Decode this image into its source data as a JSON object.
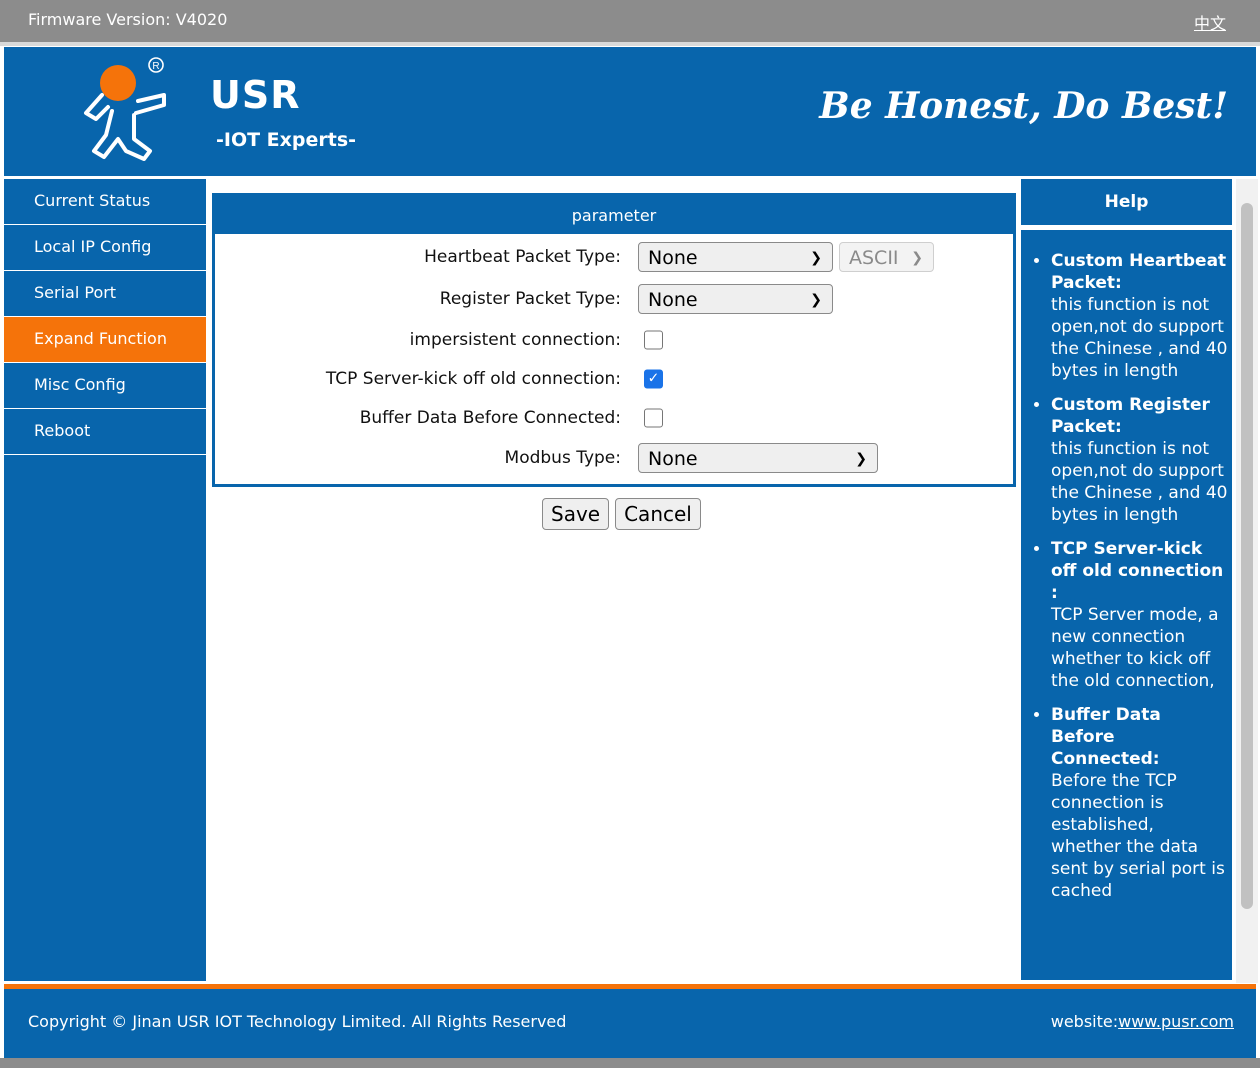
{
  "topbar": {
    "firmware_label": "Firmware Version:",
    "firmware_value": "V4020",
    "language_link": "中文"
  },
  "header": {
    "brand": "USR",
    "tagline": "-IOT Experts-",
    "slogan": "Be Honest, Do Best!"
  },
  "sidebar": {
    "items": [
      {
        "label": "Current Status",
        "active": false
      },
      {
        "label": "Local IP Config",
        "active": false
      },
      {
        "label": "Serial Port",
        "active": false
      },
      {
        "label": "Expand Function",
        "active": true
      },
      {
        "label": "Misc Config",
        "active": false
      },
      {
        "label": "Reboot",
        "active": false
      }
    ]
  },
  "panel": {
    "title": "parameter",
    "heartbeat_label": "Heartbeat Packet Type:",
    "heartbeat_value": "None",
    "heartbeat_encoding": "ASCII",
    "register_label": "Register Packet Type:",
    "register_value": "None",
    "impersistent_label": "impersistent connection:",
    "impersistent_checked": false,
    "kick_label": "TCP Server-kick off old connection:",
    "kick_checked": true,
    "buffer_label": "Buffer Data Before Connected:",
    "buffer_checked": false,
    "modbus_label": "Modbus Type:",
    "modbus_value": "None"
  },
  "buttons": {
    "save": "Save",
    "cancel": "Cancel"
  },
  "help": {
    "title": "Help",
    "items": [
      {
        "title": "Custom Heartbeat Packet:",
        "text": "this function is not open,not do support the Chinese , and 40 bytes in length"
      },
      {
        "title": "Custom Register Packet:",
        "text": "this function is not open,not do support the Chinese , and 40 bytes in length"
      },
      {
        "title": "TCP Server-kick off old connection :",
        "text": "TCP Server mode, a new connection whether to kick off the old connection,"
      },
      {
        "title": "Buffer Data Before Connected:",
        "text": "Before the TCP connection is established, whether the data sent by serial port is cached"
      }
    ]
  },
  "footer": {
    "copyright": "Copyright © Jinan USR IOT Technology Limited. All Rights Reserved",
    "website_label": "website:",
    "website_link": "www.pusr.com"
  },
  "colors": {
    "brand_blue": "#0865ac",
    "accent_orange": "#f5730a",
    "topbar_gray": "#8c8c8c"
  }
}
